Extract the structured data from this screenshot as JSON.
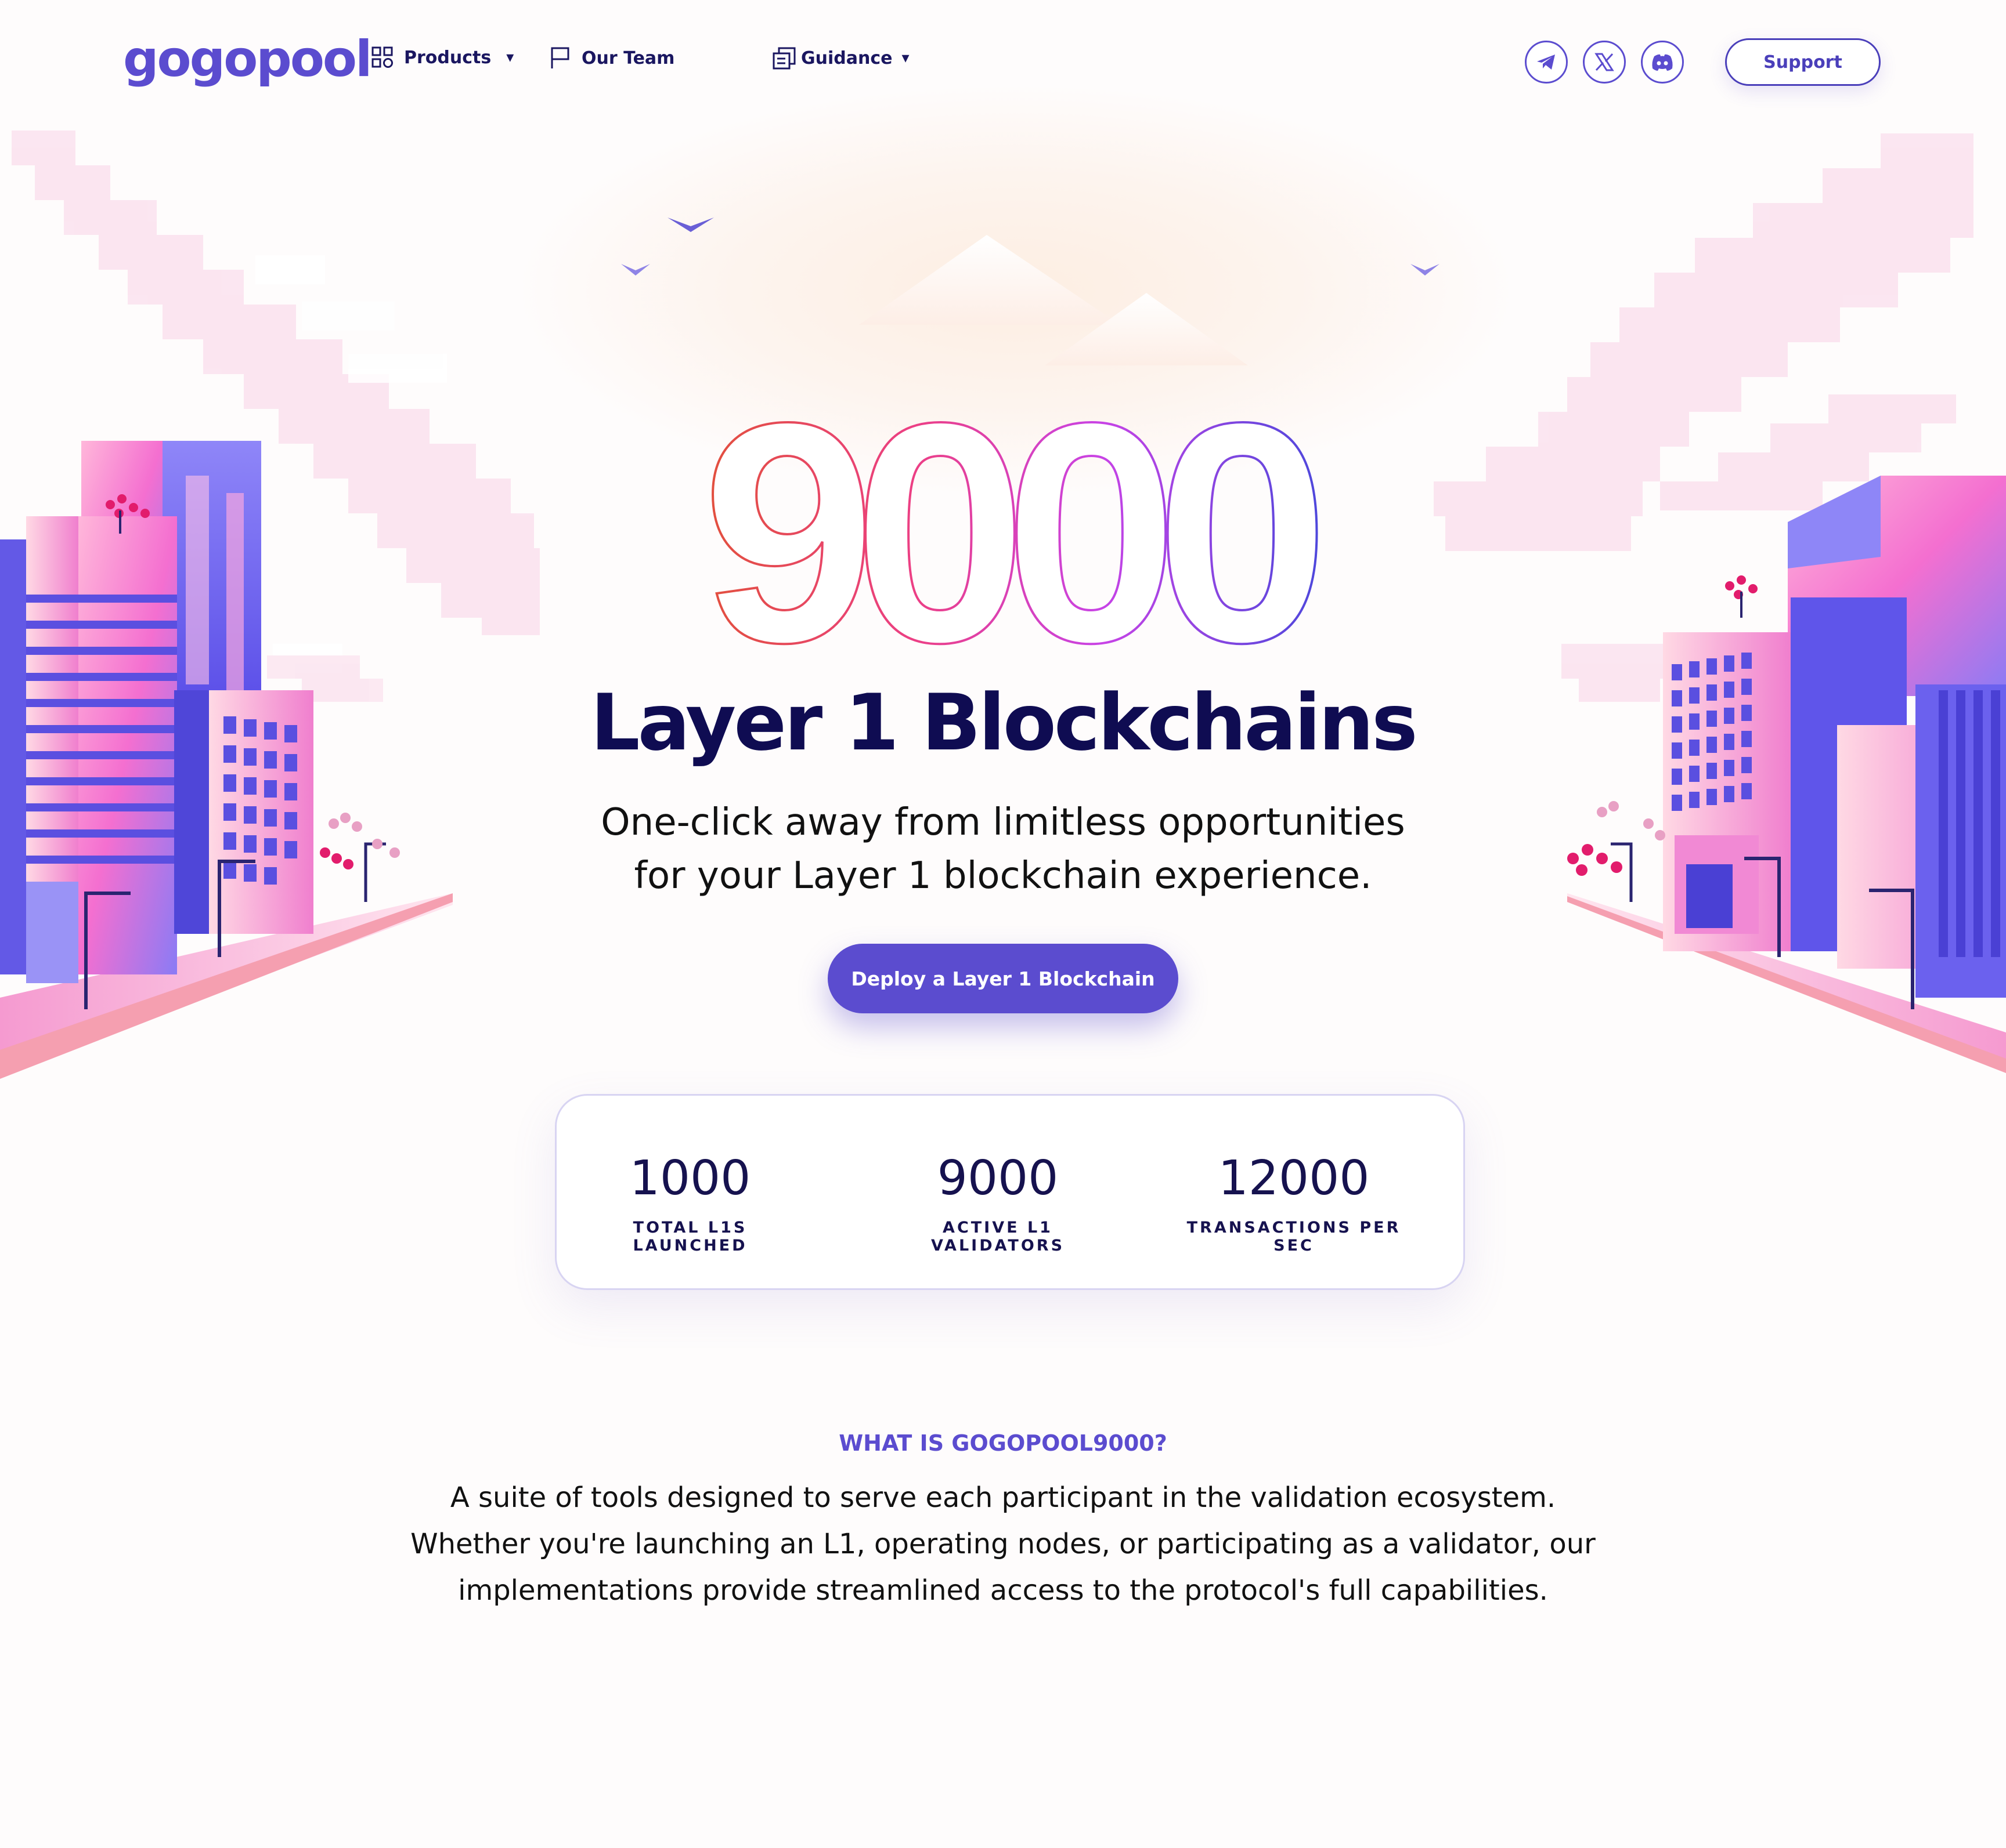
{
  "brand": {
    "logo_text": "gogopool"
  },
  "nav": {
    "products": "Products",
    "team": "Our Team",
    "guidance": "Guidance",
    "caret": "▾",
    "support": "Support"
  },
  "social": [
    "telegram-icon",
    "x-icon",
    "discord-icon"
  ],
  "hero": {
    "big_number": "9000",
    "title": "Layer 1 Blockchains",
    "subtitle_line1": "One-click away from limitless opportunities",
    "subtitle_line2": "for your Layer 1 blockchain experience.",
    "cta": "Deploy a Layer 1 Blockchain"
  },
  "stats": [
    {
      "value": "1000",
      "label": "TOTAL L1S LAUNCHED"
    },
    {
      "value": "9000",
      "label": "ACTIVE L1 VALIDATORS"
    },
    {
      "value": "12000",
      "label": "TRANSACTIONS PER SEC"
    }
  ],
  "what_is": {
    "title": "WHAT IS GOGOPOOL9000?",
    "line1": "A suite of tools designed to serve each participant in the validation ecosystem.",
    "line2": "Whether you're launching an L1, operating nodes, or participating as a validator, our",
    "line3": "implementations provide streamlined access to the protocol's full capabilities."
  },
  "colors": {
    "accent": "#5b4ccf",
    "navy": "#0f0c52",
    "pink": "#f56fc8",
    "orange": "#e0523a"
  }
}
